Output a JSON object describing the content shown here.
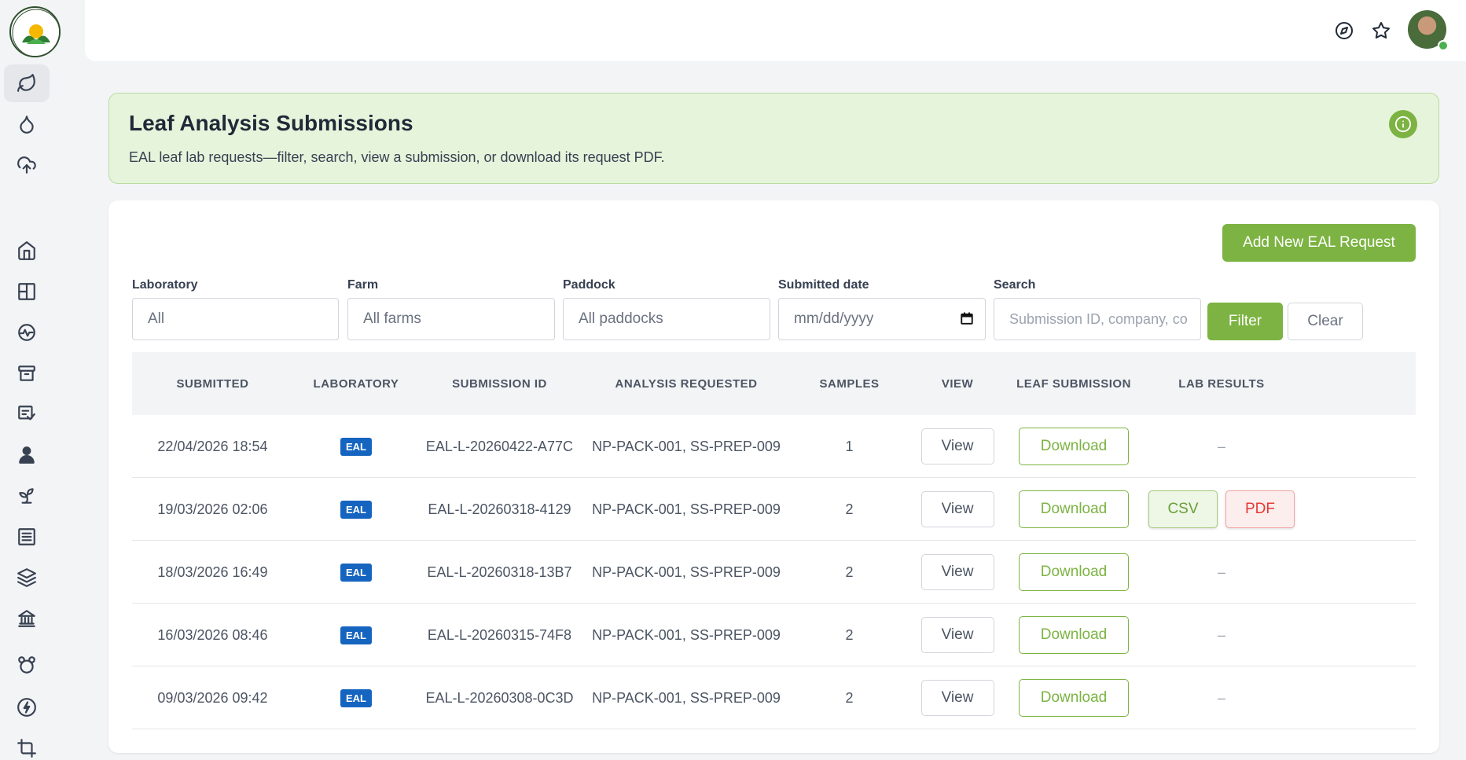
{
  "header": {
    "title": "Leaf Analysis Submissions",
    "subtitle": "EAL leaf lab requests—filter, search, view a submission, or download its request PDF."
  },
  "actions": {
    "add_request": "Add New EAL Request"
  },
  "filters": {
    "laboratory": {
      "label": "Laboratory",
      "value": "All"
    },
    "farm": {
      "label": "Farm",
      "value": "All farms"
    },
    "paddock": {
      "label": "Paddock",
      "value": "All paddocks"
    },
    "submitted_date": {
      "label": "Submitted date",
      "placeholder": "mm/dd/yyyy"
    },
    "search": {
      "label": "Search",
      "placeholder": "Submission ID, company, co"
    },
    "filter_button": "Filter",
    "clear_button": "Clear"
  },
  "table": {
    "columns": [
      "SUBMITTED",
      "LABORATORY",
      "SUBMISSION ID",
      "ANALYSIS REQUESTED",
      "SAMPLES",
      "VIEW",
      "LEAF SUBMISSION",
      "LAB RESULTS"
    ],
    "rows": [
      {
        "submitted": "22/04/2026 18:54",
        "lab": "EAL",
        "id": "EAL-L-20260422-A77C",
        "analysis": "NP-PACK-001, SS-PREP-009",
        "samples": "1",
        "view": "View",
        "download": "Download",
        "results": "–"
      },
      {
        "submitted": "19/03/2026 02:06",
        "lab": "EAL",
        "id": "EAL-L-20260318-4129",
        "analysis": "NP-PACK-001, SS-PREP-009",
        "samples": "2",
        "view": "View",
        "download": "Download",
        "csv": "CSV",
        "pdf": "PDF"
      },
      {
        "submitted": "18/03/2026 16:49",
        "lab": "EAL",
        "id": "EAL-L-20260318-13B7",
        "analysis": "NP-PACK-001, SS-PREP-009",
        "samples": "2",
        "view": "View",
        "download": "Download",
        "results": "–"
      },
      {
        "submitted": "16/03/2026 08:46",
        "lab": "EAL",
        "id": "EAL-L-20260315-74F8",
        "analysis": "NP-PACK-001, SS-PREP-009",
        "samples": "2",
        "view": "View",
        "download": "Download",
        "results": "–"
      },
      {
        "submitted": "09/03/2026 09:42",
        "lab": "EAL",
        "id": "EAL-L-20260308-0C3D",
        "analysis": "NP-PACK-001, SS-PREP-009",
        "samples": "2",
        "view": "View",
        "download": "Download",
        "results": "–"
      }
    ]
  },
  "sidebar": {
    "icons": [
      "leaf-icon",
      "droplet-icon",
      "cloud-upload-icon",
      "home-icon",
      "layout-icon",
      "activity-icon",
      "archive-icon",
      "report-icon",
      "user-icon",
      "sprout-icon",
      "list-icon",
      "layers-icon",
      "bank-icon",
      "bear-icon",
      "zap-icon",
      "crop-icon"
    ]
  },
  "colors": {
    "accent": "#7cb342",
    "badge": "#1565c0",
    "banner": "#e6f4dc"
  }
}
